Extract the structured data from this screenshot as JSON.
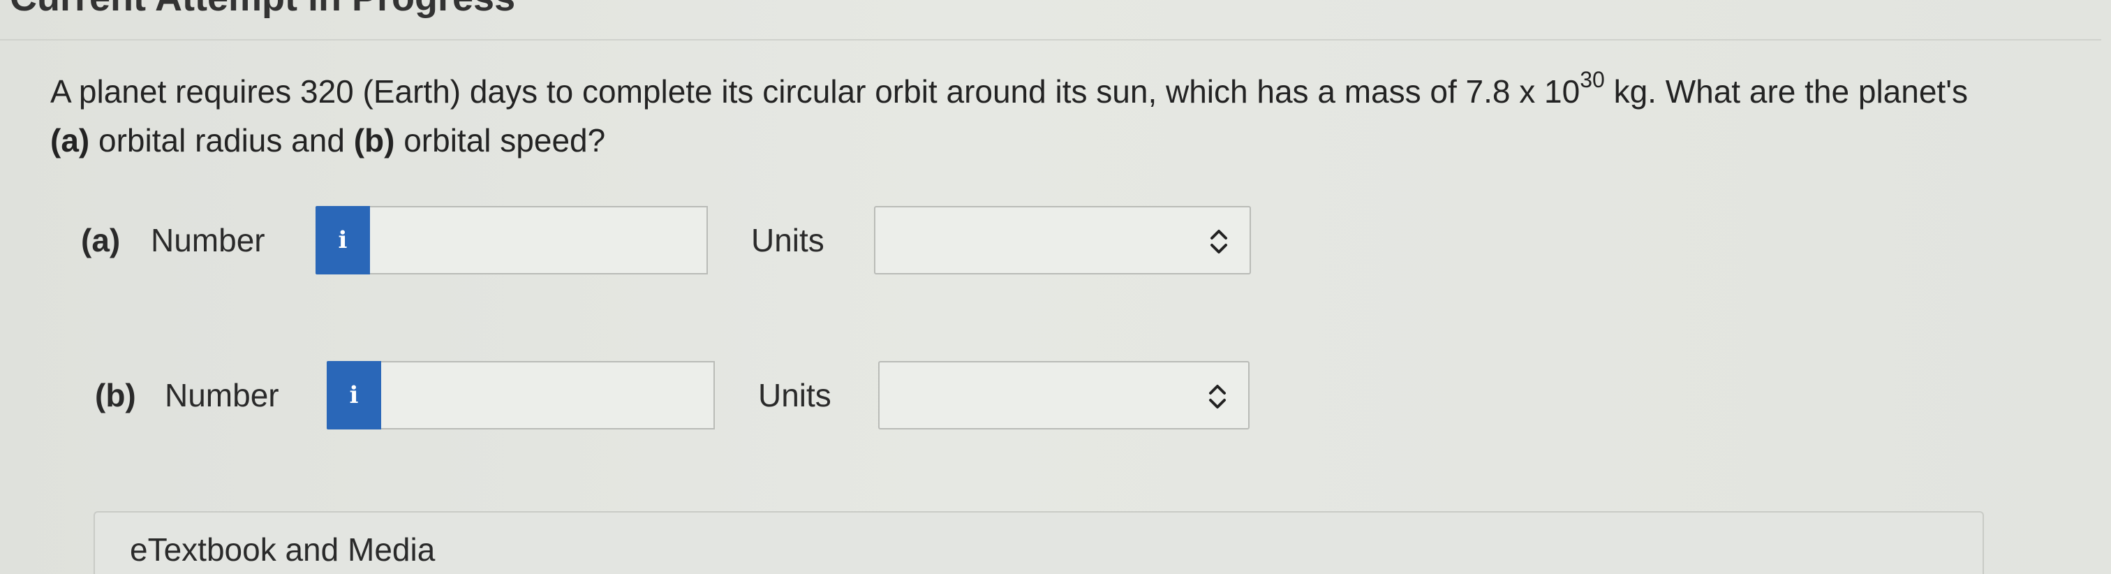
{
  "header": {
    "title": "Current Attempt in Progress"
  },
  "question": {
    "text_before_exp": "A planet requires 320 (Earth) days to complete its circular orbit around its sun, which has a mass of 7.8 x 10",
    "exponent": "30",
    "text_after_exp": " kg. What are the planet's",
    "line2_part_a": "(a)",
    "line2_mid": " orbital radius and ",
    "line2_part_b": "(b)",
    "line2_end": " orbital speed?"
  },
  "parts": [
    {
      "label": "(a)",
      "number_label": "Number",
      "info_icon": "i",
      "number_value": "",
      "units_label": "Units",
      "units_selected": ""
    },
    {
      "label": "(b)",
      "number_label": "Number",
      "info_icon": "i",
      "number_value": "",
      "units_label": "Units",
      "units_selected": ""
    }
  ],
  "etextbook": {
    "label": "eTextbook and Media"
  },
  "colors": {
    "info_button": "#2a67b8",
    "background": "#e4e6e2"
  },
  "icons": {
    "info": "info-icon",
    "select_chevron": "chevron-up-down-icon"
  }
}
